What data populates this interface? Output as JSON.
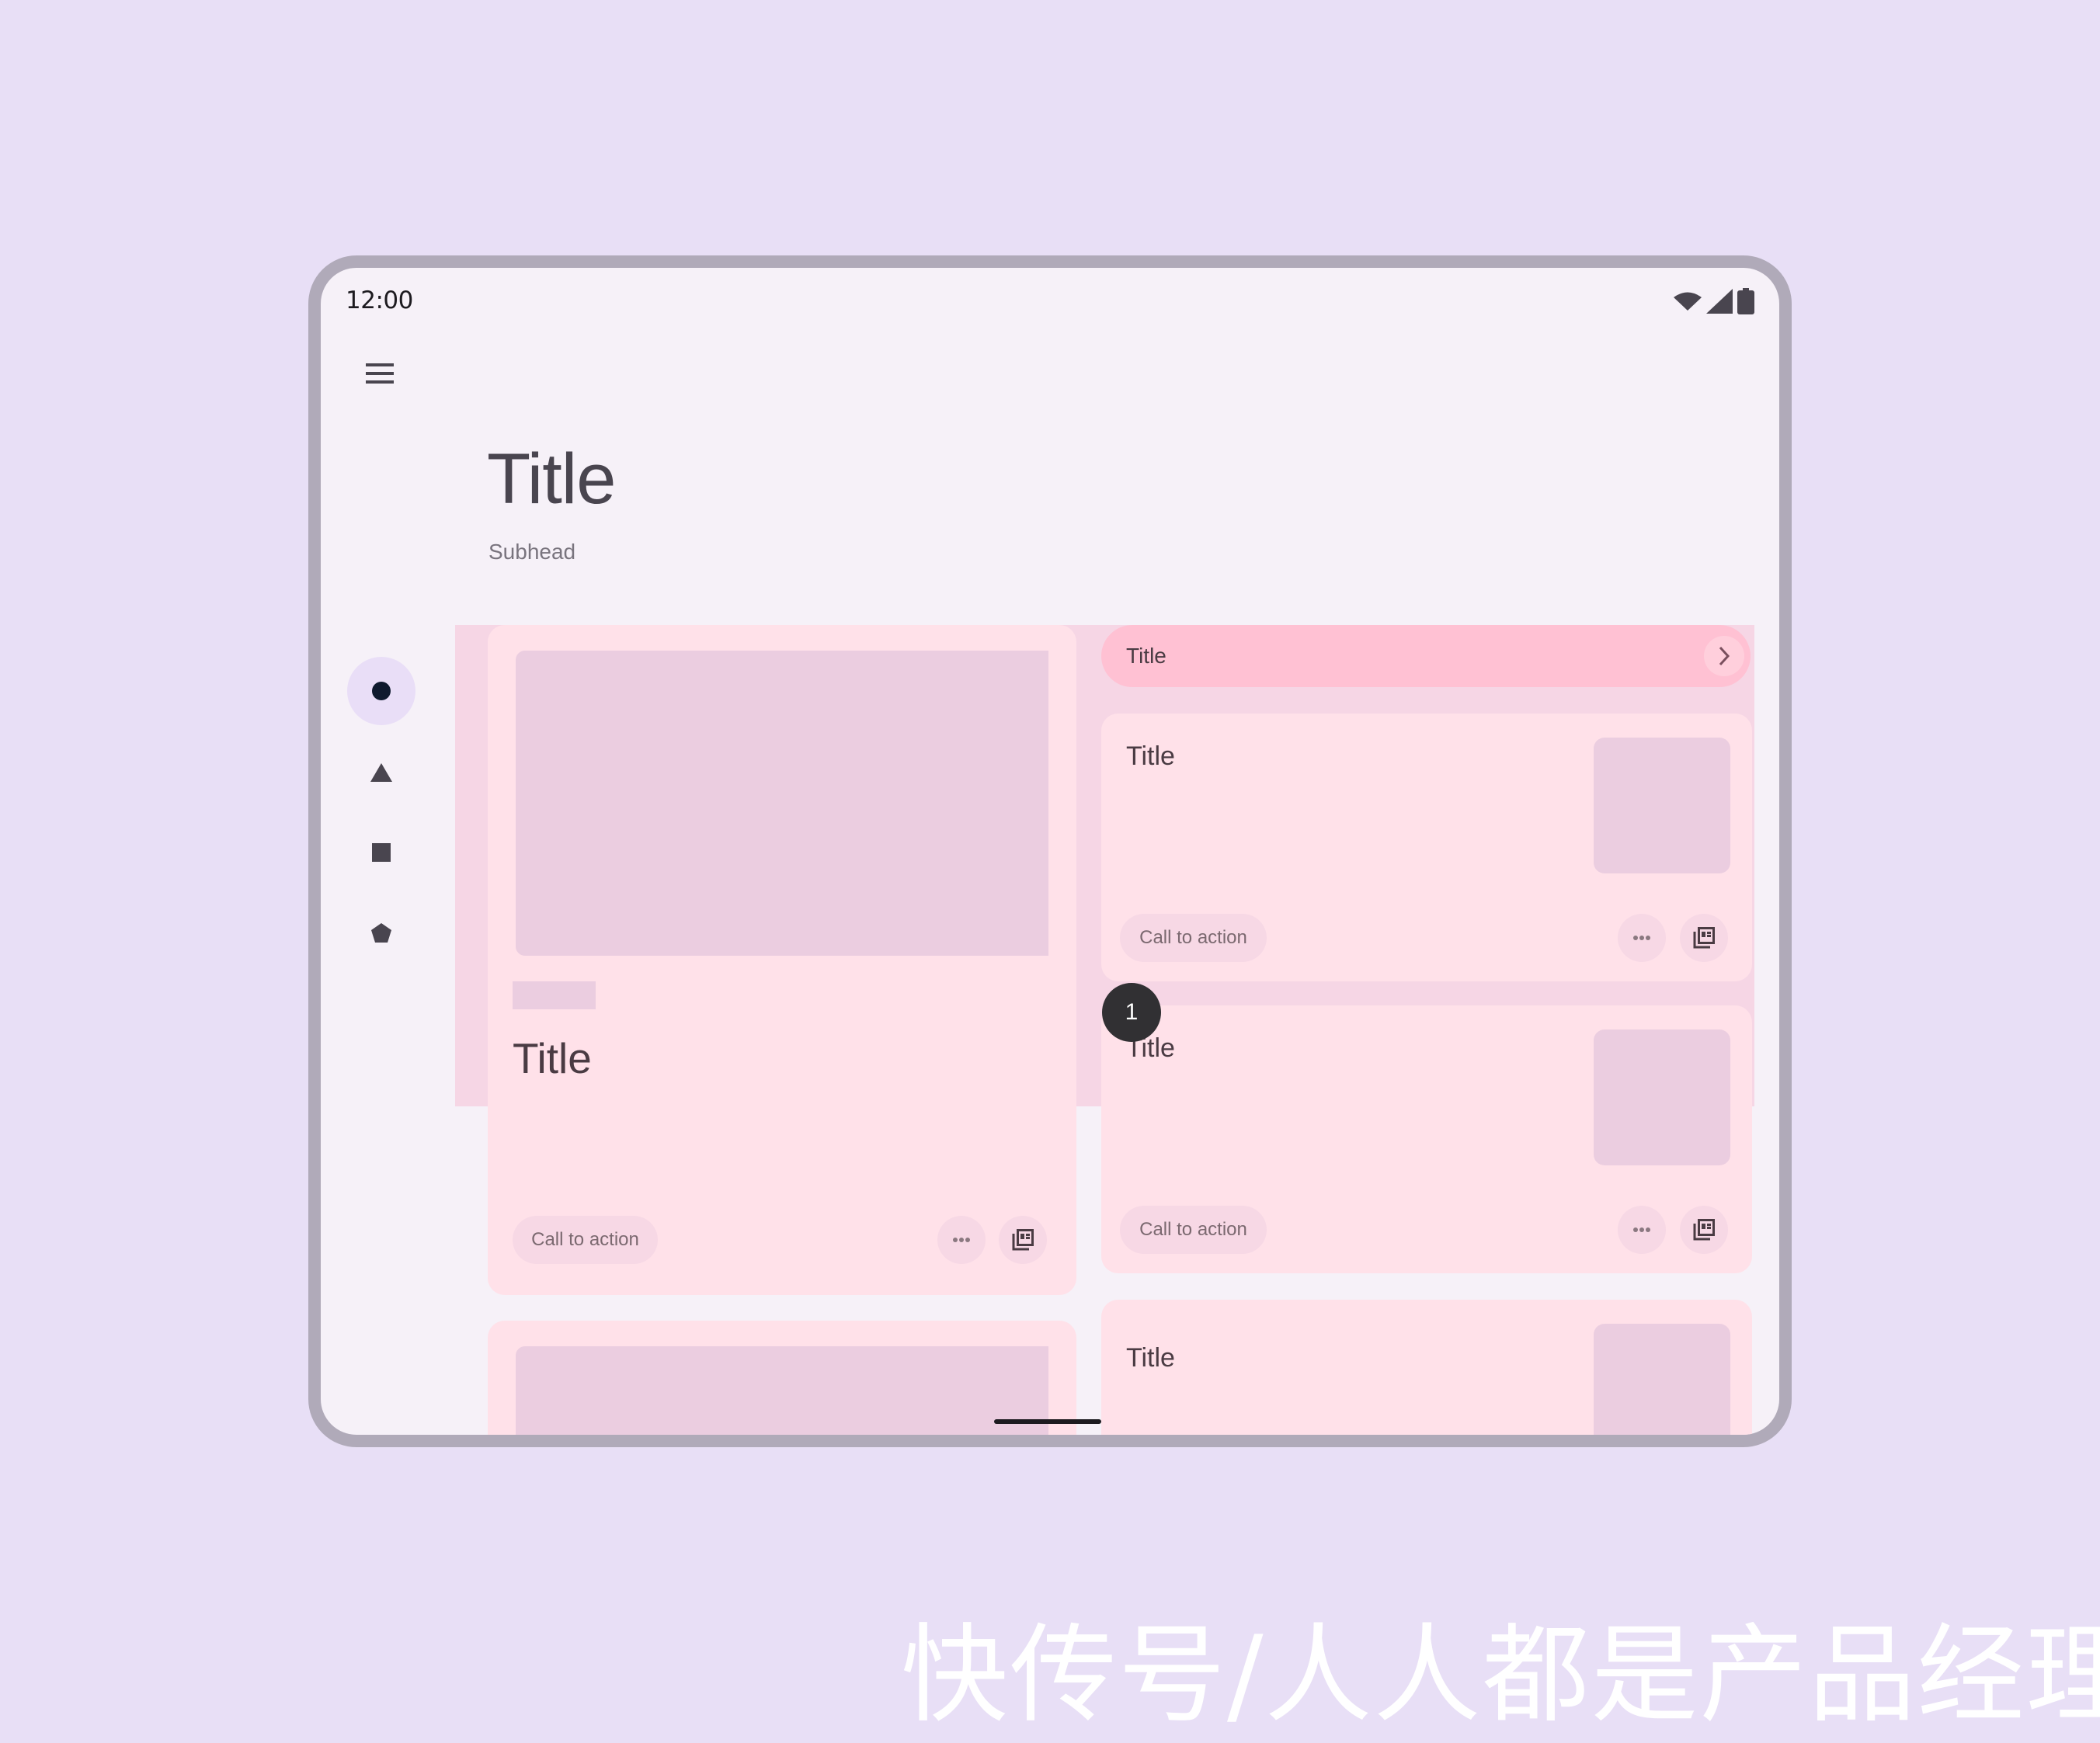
{
  "status_bar": {
    "time": "12:00",
    "icons": [
      "wifi-icon",
      "cellular-signal-icon",
      "battery-icon"
    ]
  },
  "top_app_bar": {
    "menu_icon": "hamburger-menu-icon"
  },
  "header": {
    "title": "Title",
    "subhead": "Subhead"
  },
  "navigation_rail": {
    "items": [
      {
        "icon": "circle-icon",
        "selected": true
      },
      {
        "icon": "triangle-icon",
        "selected": false
      },
      {
        "icon": "square-icon",
        "selected": false
      },
      {
        "icon": "pentagon-icon",
        "selected": false
      }
    ]
  },
  "feed": {
    "left_column": [
      {
        "title": "Title",
        "cta": "Call to action",
        "actions": [
          "more-horiz-icon",
          "gallery-icon"
        ]
      },
      {
        "title": ""
      }
    ],
    "right_column": {
      "header_chip": {
        "title": "Title",
        "icon": "chevron-right-icon"
      },
      "cards": [
        {
          "title": "Title",
          "cta": "Call to action",
          "actions": [
            "more-horiz-icon",
            "gallery-icon"
          ]
        },
        {
          "title": "Title",
          "cta": "Call to action",
          "actions": [
            "more-horiz-icon",
            "gallery-icon"
          ],
          "badge": "1"
        },
        {
          "title": "Title"
        }
      ]
    }
  },
  "colors": {
    "background": "#e8dff6",
    "device_frame": "#b0aab9",
    "surface": "#f6f1f8",
    "content_pane": "#f6d6e5",
    "card": "#ffe1e9",
    "image_placeholder": "#ebcde0",
    "header_chip": "#ffc1d3",
    "rail_selected": "#e9def7"
  },
  "watermark": "快传号/人人都是产品经理"
}
